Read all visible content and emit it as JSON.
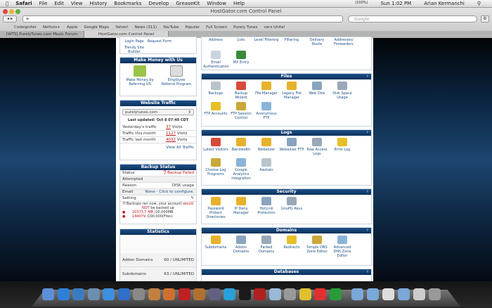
{
  "menubar": {
    "app": "Safari",
    "items": [
      "File",
      "Edit",
      "View",
      "History",
      "Bookmarks",
      "Develop",
      "GreaseKit",
      "Window",
      "Help"
    ],
    "battery": "(100%)",
    "clock": "Sun 1:02 PM",
    "user": "Arian Kermanchi"
  },
  "window": {
    "title": "HostGator.com Control Panel",
    "url": "",
    "search_placeholder": "Google"
  },
  "bookmarks": [
    "Codeigniter",
    "Nettuts+",
    "Apple",
    "Google Maps",
    "Yahoo!",
    "News (311)",
    "YouTube",
    "Popular",
    "Full Screen",
    "Purely Tunes",
    "vers Unite!"
  ],
  "tabs": [
    {
      "label": "[WTS] PurelyTunes.com Music Forum"
    },
    {
      "label": "HostGator.com Control Panel"
    }
  ],
  "left": {
    "top_links": [
      "Login Page",
      "Request Form",
      "Trendy Site Builder"
    ],
    "money": {
      "title": "Make Money with Us",
      "items": [
        "Make Money by Referring US",
        "Employee Referral Program"
      ]
    },
    "traffic": {
      "title": "Website Traffic",
      "domain": "purelytunes.com",
      "updated": "Last updated: Oct 8 07:40 CDT",
      "rows": [
        {
          "label": "Yesterday's traffic",
          "value": "37",
          "unit": "Visits"
        },
        {
          "label": "Traffic this month",
          "value": "1127",
          "unit": "Visits"
        },
        {
          "label": "Traffic last month",
          "value": "4032",
          "unit": "Visits"
        }
      ],
      "view_all": "View All Traffic"
    },
    "backup": {
      "title": "Backup Status",
      "rows": [
        {
          "label": "Status",
          "value": "Backup Failed"
        },
        {
          "label": "Attempted",
          "value": ""
        },
        {
          "label": "Reason",
          "value": "DISK usage"
        },
        {
          "label": "Email",
          "value": "None - Click to configure."
        },
        {
          "label": "Setting",
          "value": ""
        }
      ],
      "warning1": "If Backups ran now, your account",
      "warning_would": "would",
      "warning2": "NOT",
      "warning3": "be backed up",
      "disk_used": "20373.7 MB",
      "disk_limit": "/20,000MB",
      "files_used": "144079",
      "files_limit": "/100,000(Files)"
    },
    "stats": {
      "title": "Statistics",
      "rows": [
        {
          "label": "Addon Domains",
          "value": "60 / UNLIMITED"
        },
        {
          "label": "Subdomains",
          "value": "63 / UNLIMITED"
        }
      ]
    }
  },
  "right": {
    "mail_top": [
      "Address",
      "Lists",
      "Level Filtering",
      "Filtering",
      "Delivery Route",
      "Addresses/ Forwarders"
    ],
    "mail_items": [
      "Email Authentication",
      "MX Entry"
    ],
    "sections": [
      {
        "title": "Files",
        "items": [
          "Backups",
          "Backup Wizard",
          "File Manager",
          "Legacy File Manager",
          "Web Disk",
          "Disk Space Usage",
          "FTP Accounts",
          "FTP Session Control",
          "Anonymous FTP"
        ]
      },
      {
        "title": "Logs",
        "items": [
          "Latest Visitors",
          "Bandwidth",
          "Webalizer",
          "Webalizer FTP",
          "Raw Access Logs",
          "Error Log",
          "Choose Log Programs",
          "Google Analytics Integration",
          "Awstats"
        ]
      },
      {
        "title": "Security",
        "items": [
          "Password Protect Directories",
          "IP Deny Manager",
          "HotLink Protection",
          "GnuPG Keys"
        ]
      },
      {
        "title": "Domains",
        "items": [
          "Subdomains",
          "Addon Domains",
          "Parked Domains",
          "Redirects",
          "Simple DNS Zone Editor",
          "Advanced DNS Zone Editor"
        ]
      },
      {
        "title": "Databases",
        "items": []
      }
    ]
  },
  "colors": {
    "header": "#0b315c",
    "link": "#1b4f86",
    "alert": "#c0131b"
  }
}
